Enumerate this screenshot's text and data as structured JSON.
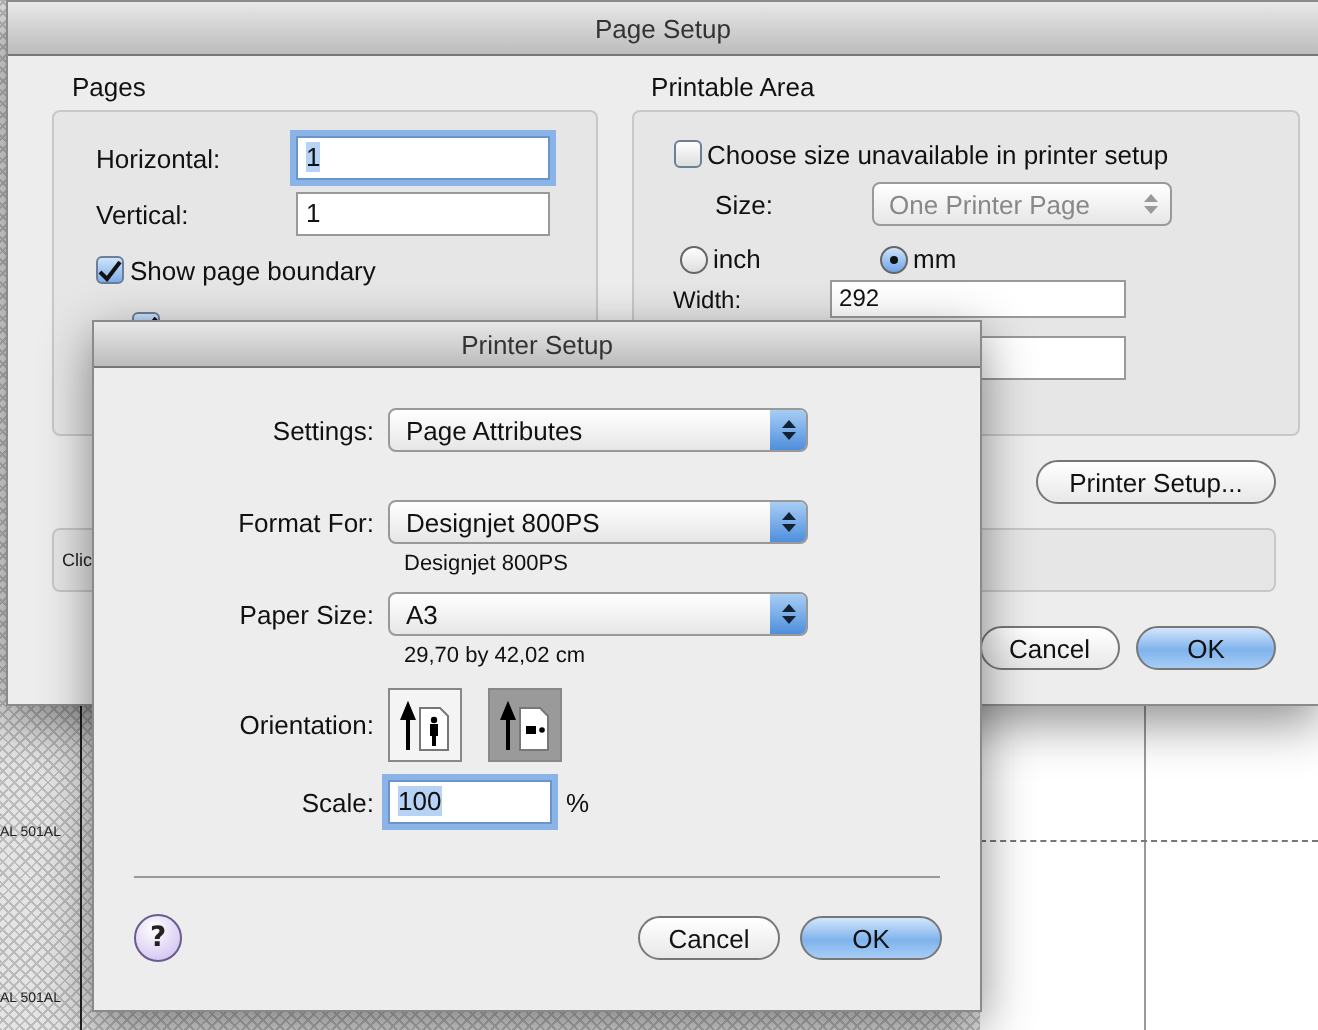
{
  "background": {
    "labels": [
      "AL 501AL",
      "AL 501AL"
    ]
  },
  "page_setup": {
    "title": "Page Setup",
    "pages": {
      "title": "Pages",
      "fields": [
        {
          "label": "Horizontal:",
          "value": "1",
          "focused": true
        },
        {
          "label": "Vertical:",
          "value": "1",
          "focused": false
        }
      ],
      "checkboxes": [
        {
          "label": "Show page boundary",
          "checked": true
        },
        {
          "checked": true
        }
      ]
    },
    "printable_area": {
      "title": "Printable Area",
      "checkbox": {
        "label": "Choose size unavailable in printer setup",
        "checked": false
      },
      "size": {
        "label": "Size:",
        "value": "One Printer Page",
        "disabled": true
      },
      "units": [
        {
          "label": "inch",
          "selected": false
        },
        {
          "label": "mm",
          "selected": true
        }
      ],
      "fields": [
        {
          "label": "Width:",
          "value": "292"
        }
      ]
    },
    "printer_setup_button": "Printer Setup...",
    "info_text": "Clic",
    "buttons": [
      {
        "label": "Cancel",
        "default": false
      },
      {
        "label": "OK",
        "default": true
      }
    ]
  },
  "printer_setup": {
    "title": "Printer Setup",
    "popups": [
      {
        "label": "Settings:",
        "value": "Page Attributes"
      },
      {
        "label": "Format For:",
        "value": "Designjet 800PS",
        "note": "Designjet 800PS"
      },
      {
        "label": "Paper Size:",
        "value": "A3",
        "note": "29,70 by 42,02 cm"
      }
    ],
    "orientation": {
      "label": "Orientation:",
      "options": [
        {
          "kind": "portrait",
          "selected": false
        },
        {
          "kind": "landscape",
          "selected": true
        }
      ]
    },
    "scale": {
      "label": "Scale:",
      "value": "100",
      "unit": "%",
      "focused": true
    },
    "help": "?",
    "buttons": [
      {
        "label": "Cancel",
        "default": false
      },
      {
        "label": "OK",
        "default": true
      }
    ]
  }
}
